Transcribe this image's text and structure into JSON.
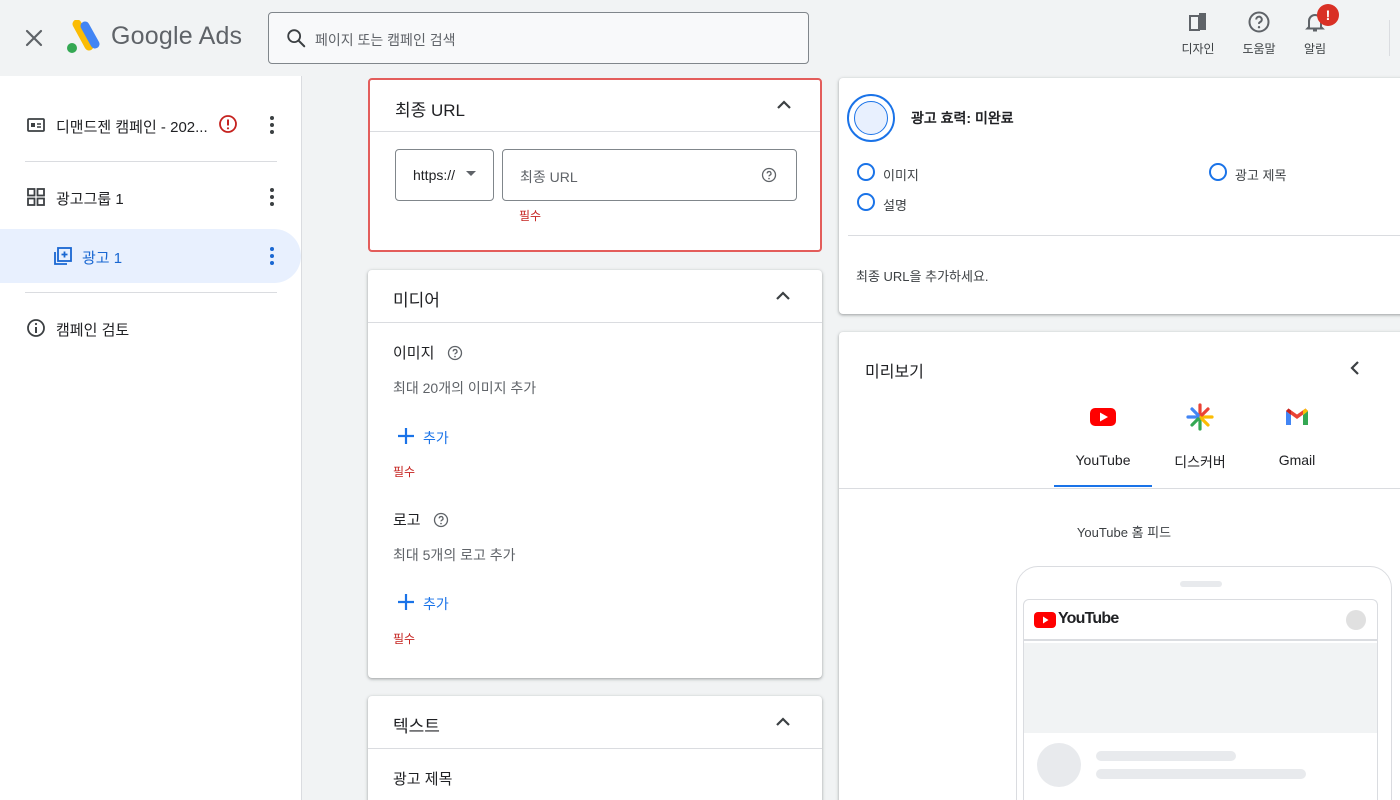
{
  "header": {
    "brand": "Google Ads",
    "search_placeholder": "페이지 또는 캠페인 검색",
    "actions": [
      {
        "label": "디자인",
        "icon": "design-icon"
      },
      {
        "label": "도움말",
        "icon": "help-icon"
      },
      {
        "label": "알림",
        "icon": "bell-icon",
        "badge": "!"
      }
    ]
  },
  "sidebar": {
    "items": [
      {
        "label": "디맨드젠 캠페인 - 202...",
        "icon": "campaign-icon",
        "has_error": true
      },
      {
        "label": "광고그룹 1",
        "icon": "ad-group-icon"
      },
      {
        "label": "광고 1",
        "icon": "ad-icon",
        "active": true
      },
      {
        "label": "캠페인 검토",
        "icon": "info-icon"
      }
    ]
  },
  "url_card": {
    "title": "최종 URL",
    "protocol": "https://",
    "url_placeholder": "최종 URL",
    "required": "필수"
  },
  "media_card": {
    "title": "미디어",
    "image_label": "이미지",
    "image_hint": "최대 20개의 이미지 추가",
    "image_add": "추가",
    "image_required": "필수",
    "logo_label": "로고",
    "logo_hint": "최대 5개의 로고 추가",
    "logo_add": "추가",
    "logo_required": "필수"
  },
  "text_card": {
    "title": "텍스트",
    "headline_label": "광고 제목"
  },
  "strength_card": {
    "title": "광고 효력: 미완료",
    "checklist": [
      "이미지",
      "광고 제목",
      "설명"
    ],
    "note": "최종 URL을 추가하세요."
  },
  "preview_card": {
    "title": "미리보기",
    "tabs": [
      "YouTube",
      "디스커버",
      "Gmail"
    ],
    "active_tab": "YouTube",
    "feed_label": "YouTube 홈 피드",
    "yt_word": "YouTube"
  },
  "colors": {
    "accent": "#1a73e8",
    "error": "#d93025",
    "url_card_border": "#e35d5b",
    "active_nav_bg": "#e8f0fe"
  }
}
